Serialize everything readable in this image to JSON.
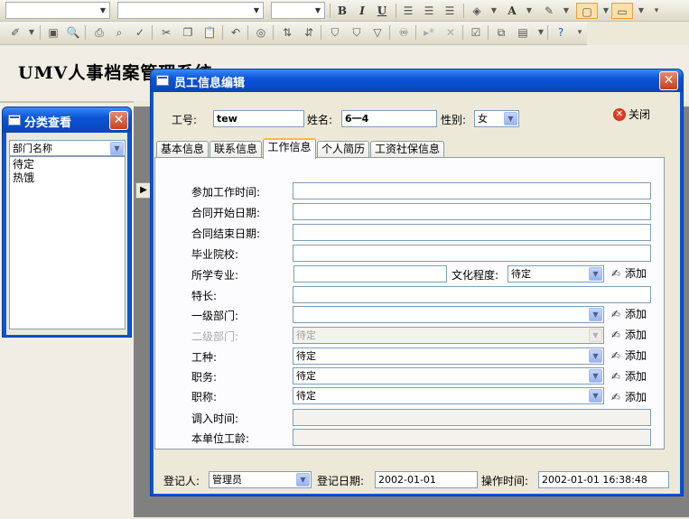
{
  "app": {
    "title": "UMV人事档案管理系统"
  },
  "toolbar": {
    "font_combo_1": "",
    "font_combo_2": "",
    "size_combo": "",
    "buttons_row1": [
      "B",
      "I",
      "U",
      "align-left-icon",
      "align-center-icon",
      "align-right-icon",
      "fill-color-icon",
      "font-color-icon",
      "line-color-icon",
      "border-icon",
      "special-effect-icon"
    ],
    "buttons_row2": [
      "design-view-icon",
      "save-icon",
      "print-icon",
      "print-preview-icon",
      "spelling-icon",
      "cut-icon",
      "copy-icon",
      "paste-icon",
      "undo-icon",
      "hyperlink-icon",
      "sort-ascending-icon",
      "sort-descending-icon",
      "filter-by-selection-icon",
      "filter-by-form-icon",
      "apply-filter-icon",
      "find-icon",
      "new-record-icon",
      "delete-record-icon",
      "properties-icon",
      "database-window-icon",
      "new-object-icon",
      "help-icon"
    ]
  },
  "category_window": {
    "title": "分类查看",
    "selector": "部门名称",
    "items": [
      "待定",
      "热饿"
    ]
  },
  "editor": {
    "title": "员工信息编辑",
    "close_label": "关闭",
    "header": {
      "id_label": "工号:",
      "id_value": "tew",
      "name_label": "姓名:",
      "name_value": "6一4",
      "gender_label": "性别:",
      "gender_value": "女"
    },
    "tabs": [
      "基本信息",
      "联系信息",
      "工作信息",
      "个人简历",
      "工资社保信息"
    ],
    "active_tab": "工作信息",
    "fields": {
      "join_work_date": {
        "label": "参加工作时间:",
        "value": ""
      },
      "contract_start": {
        "label": "合同开始日期:",
        "value": ""
      },
      "contract_end": {
        "label": "合同结束日期:",
        "value": ""
      },
      "school": {
        "label": "毕业院校:",
        "value": ""
      },
      "major": {
        "label": "所学专业:",
        "value": ""
      },
      "education": {
        "label": "文化程度:",
        "value": "待定"
      },
      "specialty": {
        "label": "特长:",
        "value": ""
      },
      "dept1": {
        "label": "一级部门:",
        "value": ""
      },
      "dept2": {
        "label": "二级部门:",
        "value": "待定"
      },
      "job_type": {
        "label": "工种:",
        "value": "待定"
      },
      "position": {
        "label": "职务:",
        "value": "待定"
      },
      "title": {
        "label": "职称:",
        "value": "待定"
      },
      "transfer_date": {
        "label": "调入时间:",
        "value": ""
      },
      "seniority": {
        "label": "本单位工龄:",
        "value": ""
      }
    },
    "add_label": "添加",
    "footer": {
      "registrar_label": "登记人:",
      "registrar_value": "管理员",
      "reg_date_label": "登记日期:",
      "reg_date_value": "2002-01-01",
      "op_time_label": "操作时间:",
      "op_time_value": "2002-01-01 16:38:48"
    }
  },
  "colors": {
    "titlebar": "#0a55d8",
    "tab_highlight": "#f9b84a",
    "close_red": "#c6411c"
  }
}
